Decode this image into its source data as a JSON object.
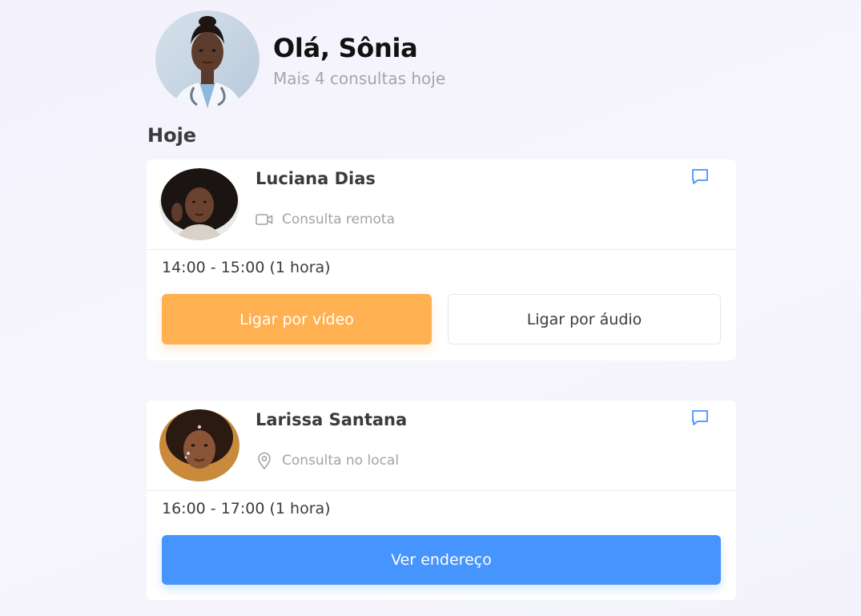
{
  "header": {
    "greeting": "Olá, Sônia",
    "subtitle": "Mais 4 consultas hoje",
    "avatar_icon": "doctor-avatar"
  },
  "section": {
    "title": "Hoje"
  },
  "appointments": [
    {
      "patient_name": "Luciana Dias",
      "consult_type": "Consulta remota",
      "type_icon": "video-camera-icon",
      "time_range": "14:00 - 15:00 (1 hora)",
      "primary_button": "Ligar por vídeo",
      "secondary_button": "Ligar por áudio"
    },
    {
      "patient_name": "Larissa Santana",
      "consult_type": "Consulta no local",
      "type_icon": "location-pin-icon",
      "time_range": "16:00 - 17:00 (1 hora)",
      "primary_button": "Ver endereço"
    }
  ],
  "colors": {
    "accent_orange": "#ffb151",
    "accent_blue": "#4694fd",
    "icon_blue": "#4694fd",
    "muted_text": "#a3a3a8",
    "background": "#f5f4fc"
  }
}
